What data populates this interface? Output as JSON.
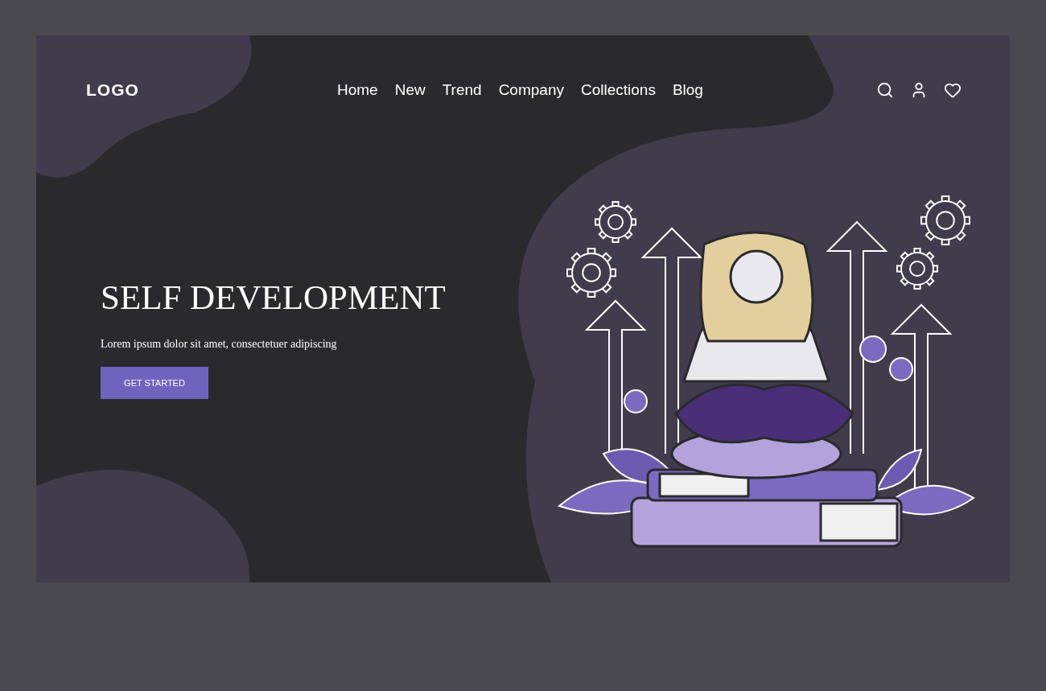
{
  "header": {
    "logo": "LOGO",
    "nav_links": [
      {
        "label": "Home"
      },
      {
        "label": "New"
      },
      {
        "label": "Trend"
      },
      {
        "label": "Company"
      },
      {
        "label": "Collections"
      },
      {
        "label": "Blog"
      }
    ]
  },
  "hero": {
    "title": "SELF DEVELOPMENT",
    "subtitle": "Lorem ipsum dolor sit amet, consectetuer adipiscing",
    "button": "GET STARTED"
  }
}
